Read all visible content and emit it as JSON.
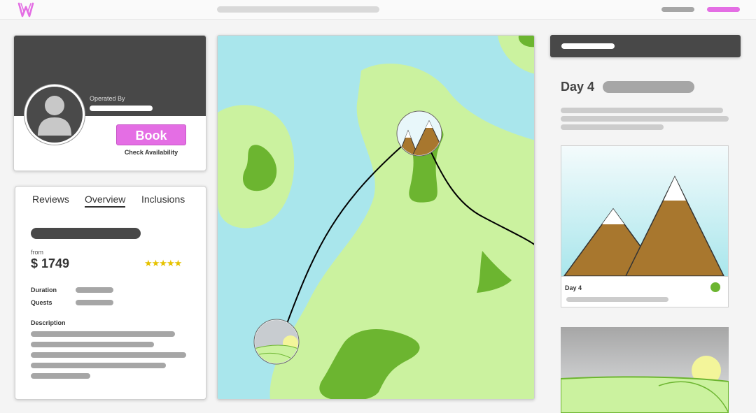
{
  "brand": {
    "logo": "W",
    "accent": "#e46ee4"
  },
  "operator": {
    "label": "Operated By",
    "book_label": "Book",
    "check_availability": "Check Availability"
  },
  "info": {
    "tabs": [
      {
        "label": "Reviews",
        "active": false
      },
      {
        "label": "Overview",
        "active": true
      },
      {
        "label": "Inclusions",
        "active": false
      }
    ],
    "from_label": "from",
    "price": "$ 1749",
    "rating_stars": "★★★★★",
    "duration_label": "Duration",
    "quests_label": "Quests",
    "description_label": "Description"
  },
  "itinerary": {
    "day_title": "Day 4",
    "photo_caption": "Day 4",
    "status_color": "#6cb530"
  },
  "map": {
    "water_color": "#a9e6ec",
    "land_color": "#cbf29f",
    "forest_color": "#6cb530"
  }
}
